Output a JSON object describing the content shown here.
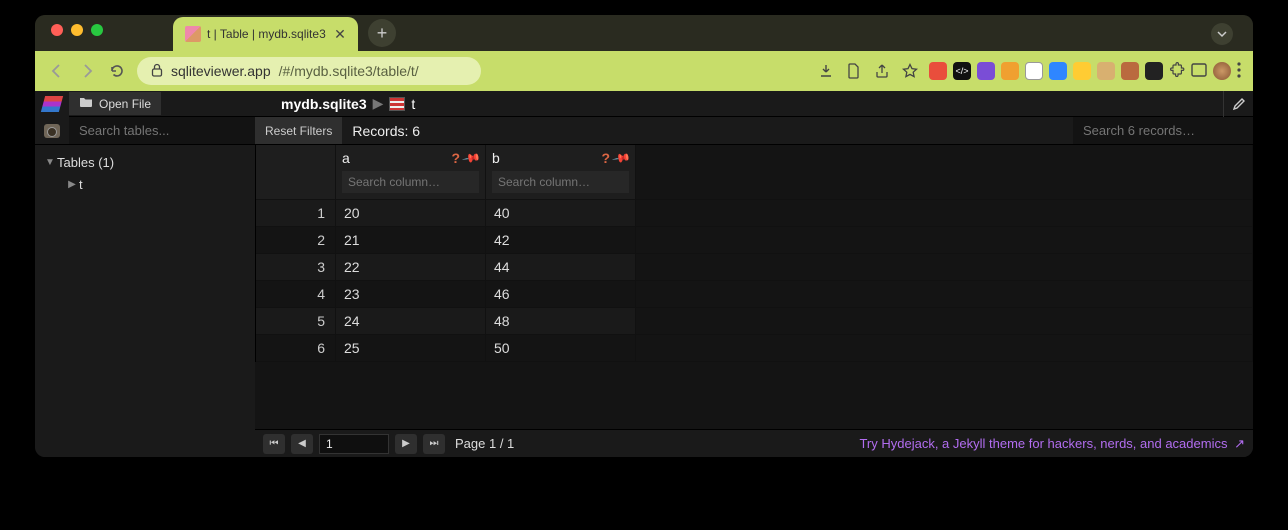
{
  "browser": {
    "tab_title": "t | Table | mydb.sqlite3",
    "url_host": "sqliteviewer.app",
    "url_path": "/#/mydb.sqlite3/table/t/"
  },
  "toolbar": {
    "open_file_label": "Open File"
  },
  "breadcrumb": {
    "db": "mydb.sqlite3",
    "table": "t"
  },
  "sidebar": {
    "search_placeholder": "Search tables...",
    "group_label": "Tables (1)",
    "items": [
      {
        "name": "t"
      }
    ]
  },
  "filters": {
    "reset_label": "Reset Filters",
    "records_label": "Records: 6",
    "search_records_placeholder": "Search 6 records…"
  },
  "columns": [
    {
      "name": "a",
      "search_placeholder": "Search column…"
    },
    {
      "name": "b",
      "search_placeholder": "Search column…"
    }
  ],
  "rows": [
    {
      "n": "1",
      "a": "20",
      "b": "40"
    },
    {
      "n": "2",
      "a": "21",
      "b": "42"
    },
    {
      "n": "3",
      "a": "22",
      "b": "44"
    },
    {
      "n": "4",
      "a": "23",
      "b": "46"
    },
    {
      "n": "5",
      "a": "24",
      "b": "48"
    },
    {
      "n": "6",
      "a": "25",
      "b": "50"
    }
  ],
  "pager": {
    "current": "1",
    "page_text": "Page 1 / 1"
  },
  "promo": {
    "text": "Try Hydejack, a Jekyll theme for hackers, nerds, and academics",
    "arrow": "↗"
  }
}
